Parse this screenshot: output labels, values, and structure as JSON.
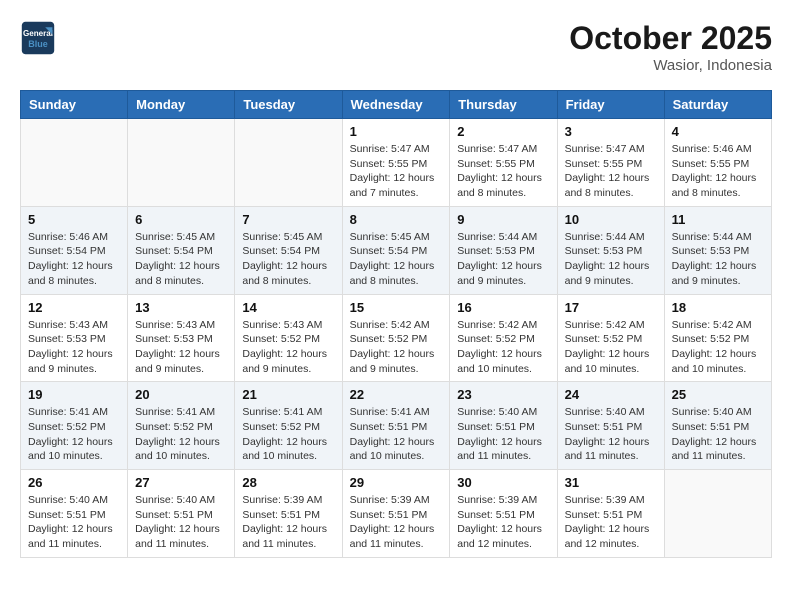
{
  "header": {
    "logo_line1": "General",
    "logo_line2": "Blue",
    "month": "October 2025",
    "location": "Wasior, Indonesia"
  },
  "days_of_week": [
    "Sunday",
    "Monday",
    "Tuesday",
    "Wednesday",
    "Thursday",
    "Friday",
    "Saturday"
  ],
  "weeks": [
    [
      {
        "day": "",
        "info": ""
      },
      {
        "day": "",
        "info": ""
      },
      {
        "day": "",
        "info": ""
      },
      {
        "day": "1",
        "info": "Sunrise: 5:47 AM\nSunset: 5:55 PM\nDaylight: 12 hours\nand 7 minutes."
      },
      {
        "day": "2",
        "info": "Sunrise: 5:47 AM\nSunset: 5:55 PM\nDaylight: 12 hours\nand 8 minutes."
      },
      {
        "day": "3",
        "info": "Sunrise: 5:47 AM\nSunset: 5:55 PM\nDaylight: 12 hours\nand 8 minutes."
      },
      {
        "day": "4",
        "info": "Sunrise: 5:46 AM\nSunset: 5:55 PM\nDaylight: 12 hours\nand 8 minutes."
      }
    ],
    [
      {
        "day": "5",
        "info": "Sunrise: 5:46 AM\nSunset: 5:54 PM\nDaylight: 12 hours\nand 8 minutes."
      },
      {
        "day": "6",
        "info": "Sunrise: 5:45 AM\nSunset: 5:54 PM\nDaylight: 12 hours\nand 8 minutes."
      },
      {
        "day": "7",
        "info": "Sunrise: 5:45 AM\nSunset: 5:54 PM\nDaylight: 12 hours\nand 8 minutes."
      },
      {
        "day": "8",
        "info": "Sunrise: 5:45 AM\nSunset: 5:54 PM\nDaylight: 12 hours\nand 8 minutes."
      },
      {
        "day": "9",
        "info": "Sunrise: 5:44 AM\nSunset: 5:53 PM\nDaylight: 12 hours\nand 9 minutes."
      },
      {
        "day": "10",
        "info": "Sunrise: 5:44 AM\nSunset: 5:53 PM\nDaylight: 12 hours\nand 9 minutes."
      },
      {
        "day": "11",
        "info": "Sunrise: 5:44 AM\nSunset: 5:53 PM\nDaylight: 12 hours\nand 9 minutes."
      }
    ],
    [
      {
        "day": "12",
        "info": "Sunrise: 5:43 AM\nSunset: 5:53 PM\nDaylight: 12 hours\nand 9 minutes."
      },
      {
        "day": "13",
        "info": "Sunrise: 5:43 AM\nSunset: 5:53 PM\nDaylight: 12 hours\nand 9 minutes."
      },
      {
        "day": "14",
        "info": "Sunrise: 5:43 AM\nSunset: 5:52 PM\nDaylight: 12 hours\nand 9 minutes."
      },
      {
        "day": "15",
        "info": "Sunrise: 5:42 AM\nSunset: 5:52 PM\nDaylight: 12 hours\nand 9 minutes."
      },
      {
        "day": "16",
        "info": "Sunrise: 5:42 AM\nSunset: 5:52 PM\nDaylight: 12 hours\nand 10 minutes."
      },
      {
        "day": "17",
        "info": "Sunrise: 5:42 AM\nSunset: 5:52 PM\nDaylight: 12 hours\nand 10 minutes."
      },
      {
        "day": "18",
        "info": "Sunrise: 5:42 AM\nSunset: 5:52 PM\nDaylight: 12 hours\nand 10 minutes."
      }
    ],
    [
      {
        "day": "19",
        "info": "Sunrise: 5:41 AM\nSunset: 5:52 PM\nDaylight: 12 hours\nand 10 minutes."
      },
      {
        "day": "20",
        "info": "Sunrise: 5:41 AM\nSunset: 5:52 PM\nDaylight: 12 hours\nand 10 minutes."
      },
      {
        "day": "21",
        "info": "Sunrise: 5:41 AM\nSunset: 5:52 PM\nDaylight: 12 hours\nand 10 minutes."
      },
      {
        "day": "22",
        "info": "Sunrise: 5:41 AM\nSunset: 5:51 PM\nDaylight: 12 hours\nand 10 minutes."
      },
      {
        "day": "23",
        "info": "Sunrise: 5:40 AM\nSunset: 5:51 PM\nDaylight: 12 hours\nand 11 minutes."
      },
      {
        "day": "24",
        "info": "Sunrise: 5:40 AM\nSunset: 5:51 PM\nDaylight: 12 hours\nand 11 minutes."
      },
      {
        "day": "25",
        "info": "Sunrise: 5:40 AM\nSunset: 5:51 PM\nDaylight: 12 hours\nand 11 minutes."
      }
    ],
    [
      {
        "day": "26",
        "info": "Sunrise: 5:40 AM\nSunset: 5:51 PM\nDaylight: 12 hours\nand 11 minutes."
      },
      {
        "day": "27",
        "info": "Sunrise: 5:40 AM\nSunset: 5:51 PM\nDaylight: 12 hours\nand 11 minutes."
      },
      {
        "day": "28",
        "info": "Sunrise: 5:39 AM\nSunset: 5:51 PM\nDaylight: 12 hours\nand 11 minutes."
      },
      {
        "day": "29",
        "info": "Sunrise: 5:39 AM\nSunset: 5:51 PM\nDaylight: 12 hours\nand 11 minutes."
      },
      {
        "day": "30",
        "info": "Sunrise: 5:39 AM\nSunset: 5:51 PM\nDaylight: 12 hours\nand 12 minutes."
      },
      {
        "day": "31",
        "info": "Sunrise: 5:39 AM\nSunset: 5:51 PM\nDaylight: 12 hours\nand 12 minutes."
      },
      {
        "day": "",
        "info": ""
      }
    ]
  ]
}
